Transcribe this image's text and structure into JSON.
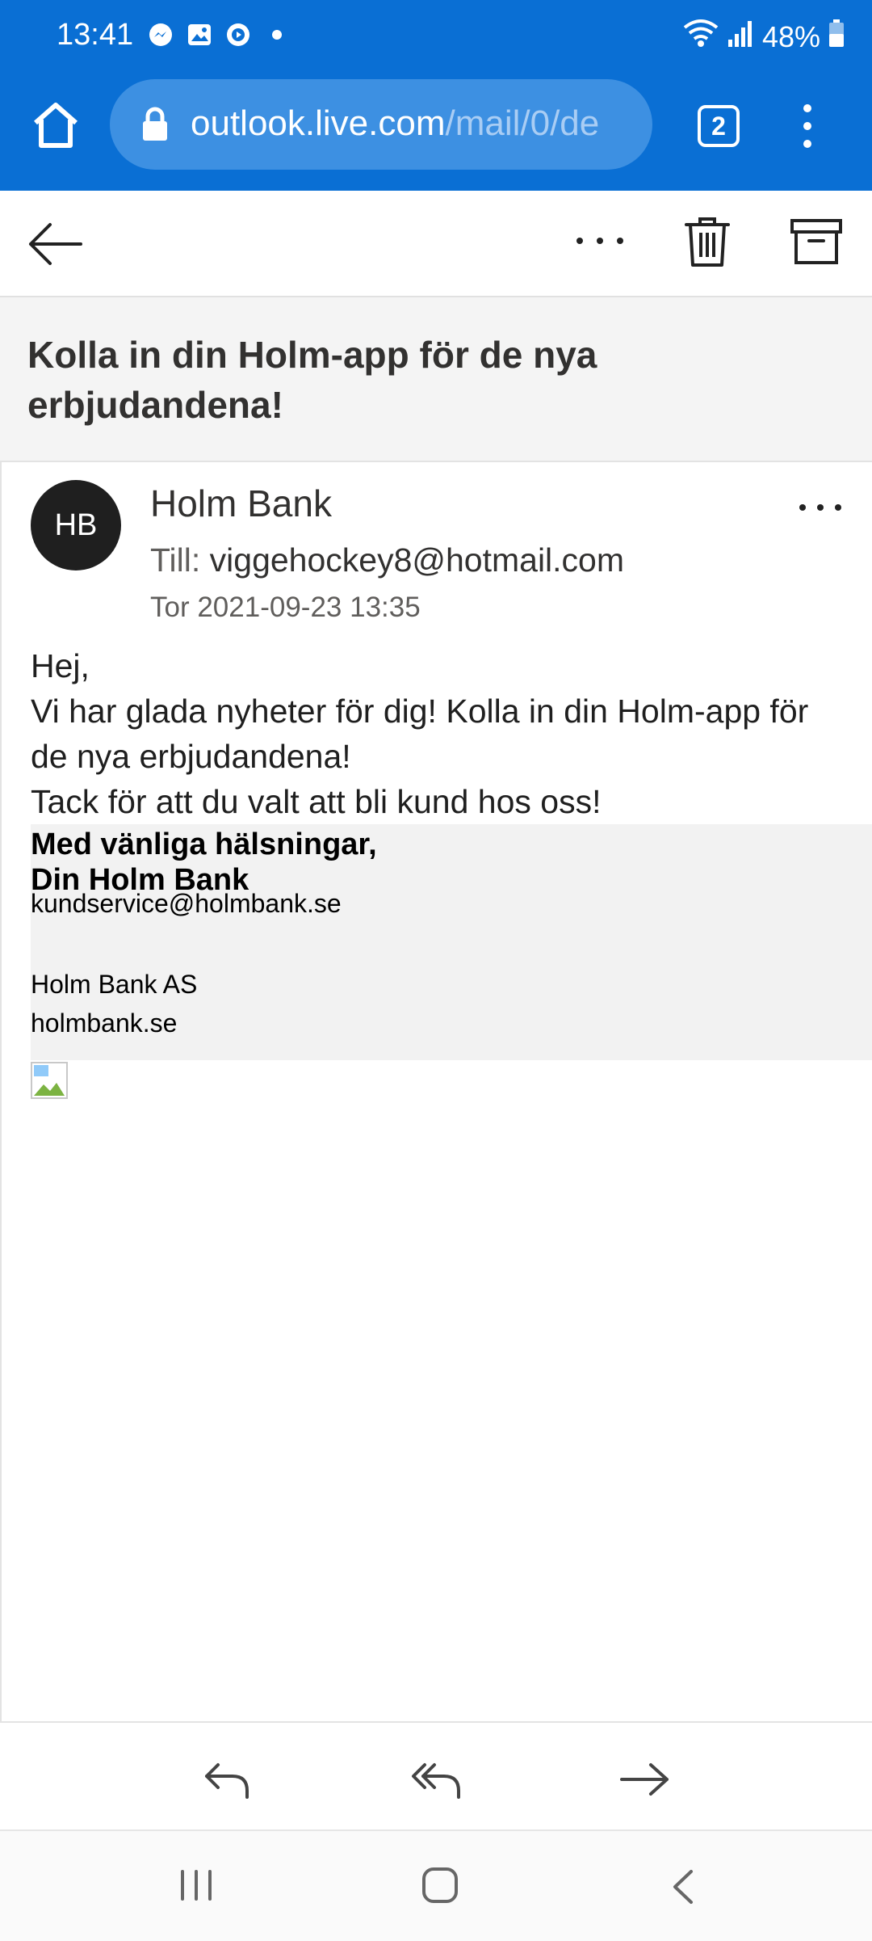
{
  "status_bar": {
    "time": "13:41",
    "battery": "48%",
    "left_icons": [
      "messenger-icon",
      "gallery-icon",
      "media-icon",
      "dot-icon"
    ],
    "right_icons": [
      "wifi-icon",
      "signal-icon",
      "battery-icon"
    ]
  },
  "browser": {
    "url_host": "outlook.live.com",
    "url_path": "/mail/0/de",
    "tab_count": "2",
    "accent": "#0a6fd4"
  },
  "email": {
    "subject": "Kolla in din Holm-app för de nya erbjudandena!",
    "avatar_initials": "HB",
    "sender": "Holm Bank",
    "to_label": "Till:",
    "to_address": "viggehockey8@hotmail.com",
    "date": "Tor 2021-09-23 13:35",
    "body": [
      "Hej,",
      "Vi har glada nyheter för dig! Kolla in din Holm-app för de nya erbjudandena!",
      "Tack för att du valt att bli kund hos oss!"
    ],
    "signature": {
      "line1": "Med vänliga hälsningar,",
      "line2": "Din Holm Bank",
      "email": "kundservice@holmbank.se",
      "company": "Holm Bank AS",
      "website": "holmbank.se"
    }
  }
}
